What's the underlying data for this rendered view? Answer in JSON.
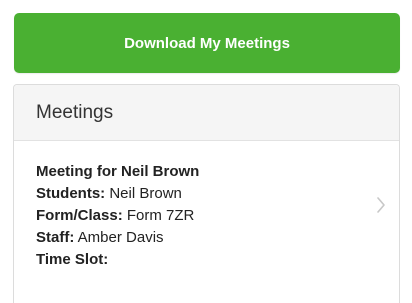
{
  "download_button": {
    "label": "Download My Meetings"
  },
  "meetings_panel": {
    "title": "Meetings",
    "items": [
      {
        "title": "Meeting for Neil Brown",
        "students_label": "Students:",
        "students_value": "Neil Brown",
        "form_label": "Form/Class:",
        "form_value": "Form 7ZR",
        "staff_label": "Staff:",
        "staff_value": "Amber Davis",
        "timeslot_label": "Time Slot:",
        "timeslot_value": ""
      }
    ]
  },
  "icons": {
    "chevron": "chevron-right-icon"
  },
  "colors": {
    "accent": "#4ab032",
    "header_bg": "#f5f5f5"
  }
}
